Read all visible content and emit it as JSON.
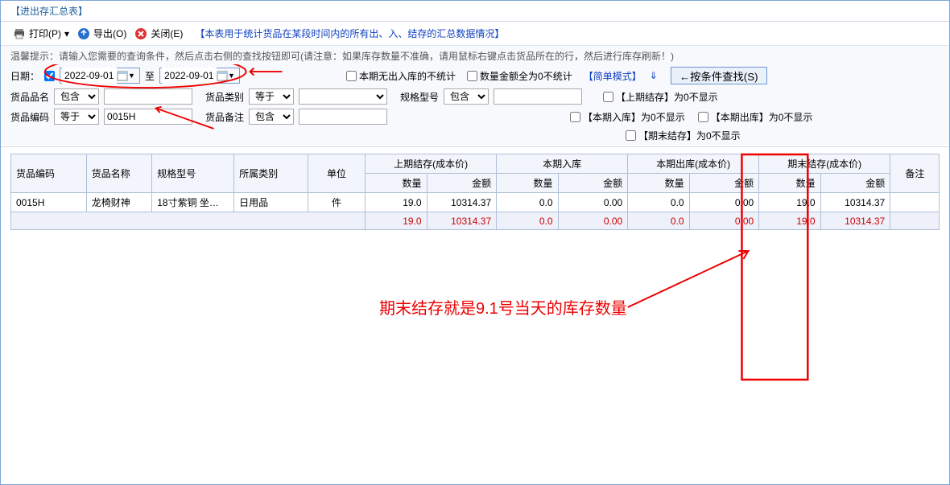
{
  "window": {
    "title": "【进出存汇总表】"
  },
  "toolbar": {
    "print": "打印(P)",
    "export": "导出(O)",
    "close": "关闭(E)",
    "desc": "【本表用于统计货品在某段时间内的所有出、入、结存的汇总数据情况】"
  },
  "tip": "温馨提示：请输入您需要的查询条件，然后点击右侧的查找按钮即可(请注意：如果库存数量不准确，请用鼠标右键点击货品所在的行，然后进行库存刷新！)",
  "filters": {
    "date_label": "日期：",
    "date_from": "2022-09-01",
    "date_to_label": "至",
    "date_to": "2022-09-01",
    "no_io_label": "本期无出入库的不统计",
    "zero_label": "数量金额全为0不统计",
    "simple_mode": "【简单模式】",
    "arrow": "⇓",
    "search_btn": "←按条件查找(S)",
    "prod_name_label": "货品品名",
    "prod_name_op": "包含",
    "prod_name_val": "",
    "prod_cat_label": "货品类别",
    "prod_cat_op": "等于",
    "prod_cat_val": "",
    "spec_label": "规格型号",
    "spec_op": "包含",
    "spec_val": "",
    "prev_zero_label": "【上期结存】为0不显示",
    "prod_code_label": "货品编码",
    "prod_code_op": "等于",
    "prod_code_val": "0015H",
    "remark_label": "货品备注",
    "remark_op": "包含",
    "remark_val": "",
    "in_zero_label": "【本期入库】为0不显示",
    "out_zero_label": "【本期出库】为0不显示",
    "end_zero_label": "【期末结存】为0不显示"
  },
  "headers": {
    "code": "货品编码",
    "name": "货品名称",
    "spec": "规格型号",
    "cat": "所属类别",
    "unit": "单位",
    "prev": "上期结存(成本价)",
    "in": "本期入库",
    "out": "本期出库(成本价)",
    "end": "期末结存(成本价)",
    "qty": "数量",
    "amt": "金额",
    "note": "备注"
  },
  "rows": [
    {
      "code": "0015H",
      "name": "龙椅财神",
      "spec": "18寸紫铜 坐…",
      "cat": "日用品",
      "unit": "件",
      "prev_qty": "19.0",
      "prev_amt": "10314.37",
      "in_qty": "0.0",
      "in_amt": "0.00",
      "out_qty": "0.0",
      "out_amt": "0.00",
      "end_qty": "19.0",
      "end_amt": "10314.37",
      "note": ""
    }
  ],
  "sum": {
    "prev_qty": "19.0",
    "prev_amt": "10314.37",
    "in_qty": "0.0",
    "in_amt": "0.00",
    "out_qty": "0.0",
    "out_amt": "0.00",
    "end_qty": "19.0",
    "end_amt": "10314.37"
  },
  "annotation": {
    "text": "期末结存就是9.1号当天的库存数量"
  }
}
